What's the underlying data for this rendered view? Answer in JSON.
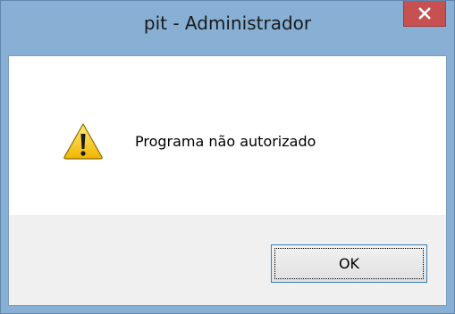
{
  "window": {
    "title": "pit - Administrador",
    "close_icon": "close-icon"
  },
  "dialog": {
    "icon": "warning-icon",
    "message": "Programa não autorizado",
    "ok_label": "OK"
  },
  "colors": {
    "frame": "#88b0d4",
    "close_button": "#c75050",
    "button_area": "#f0f0f0",
    "focus_border": "#3c7fb1"
  }
}
